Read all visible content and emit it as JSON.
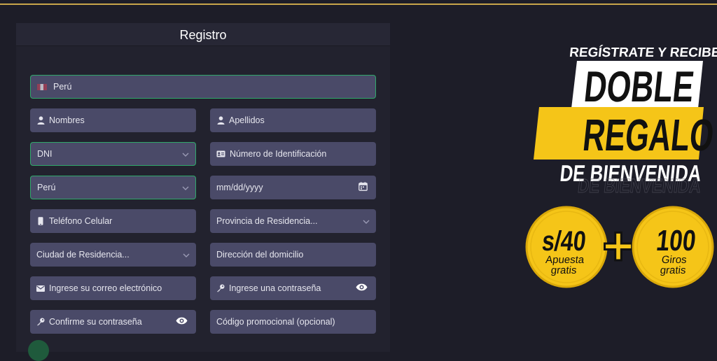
{
  "form": {
    "title": "Registro",
    "country_field": "Perú",
    "first_name_placeholder": "Nombres",
    "last_name_placeholder": "Apellidos",
    "doc_type": "DNI",
    "doc_number_placeholder": "Número de Identificación",
    "nationality": "Perú",
    "birthdate_placeholder": "mm/dd/yyyy",
    "phone_placeholder": "Teléfono Celular",
    "province_placeholder": "Provincia de Residencia...",
    "city_placeholder": "Ciudad de Residencia...",
    "address_placeholder": "Dirección del domicilio",
    "email_placeholder": "Ingrese su correo electrónico",
    "password_placeholder": "Ingrese una contraseña",
    "confirm_password_placeholder": "Confirme su contraseña",
    "promo_code_placeholder": "Código promocional (opcional)"
  },
  "promo": {
    "line1": "REGÍSTRATE Y RECIBE",
    "line2": "DOBLE",
    "line3": "REGALO",
    "line4": "DE BIENVENIDA",
    "line4_echo": "DE BIENVENIDA",
    "coin1_amount": "s/40",
    "coin1_line1": "Apuesta",
    "coin1_line2": "gratis",
    "plus": "+",
    "coin2_amount": "100",
    "coin2_line1": "Giros",
    "coin2_line2": "gratis"
  },
  "colors": {
    "background": "#1d1d28",
    "field": "#4a4a68",
    "accent_gold": "#f5c518",
    "valid_border": "#2fa86a"
  }
}
